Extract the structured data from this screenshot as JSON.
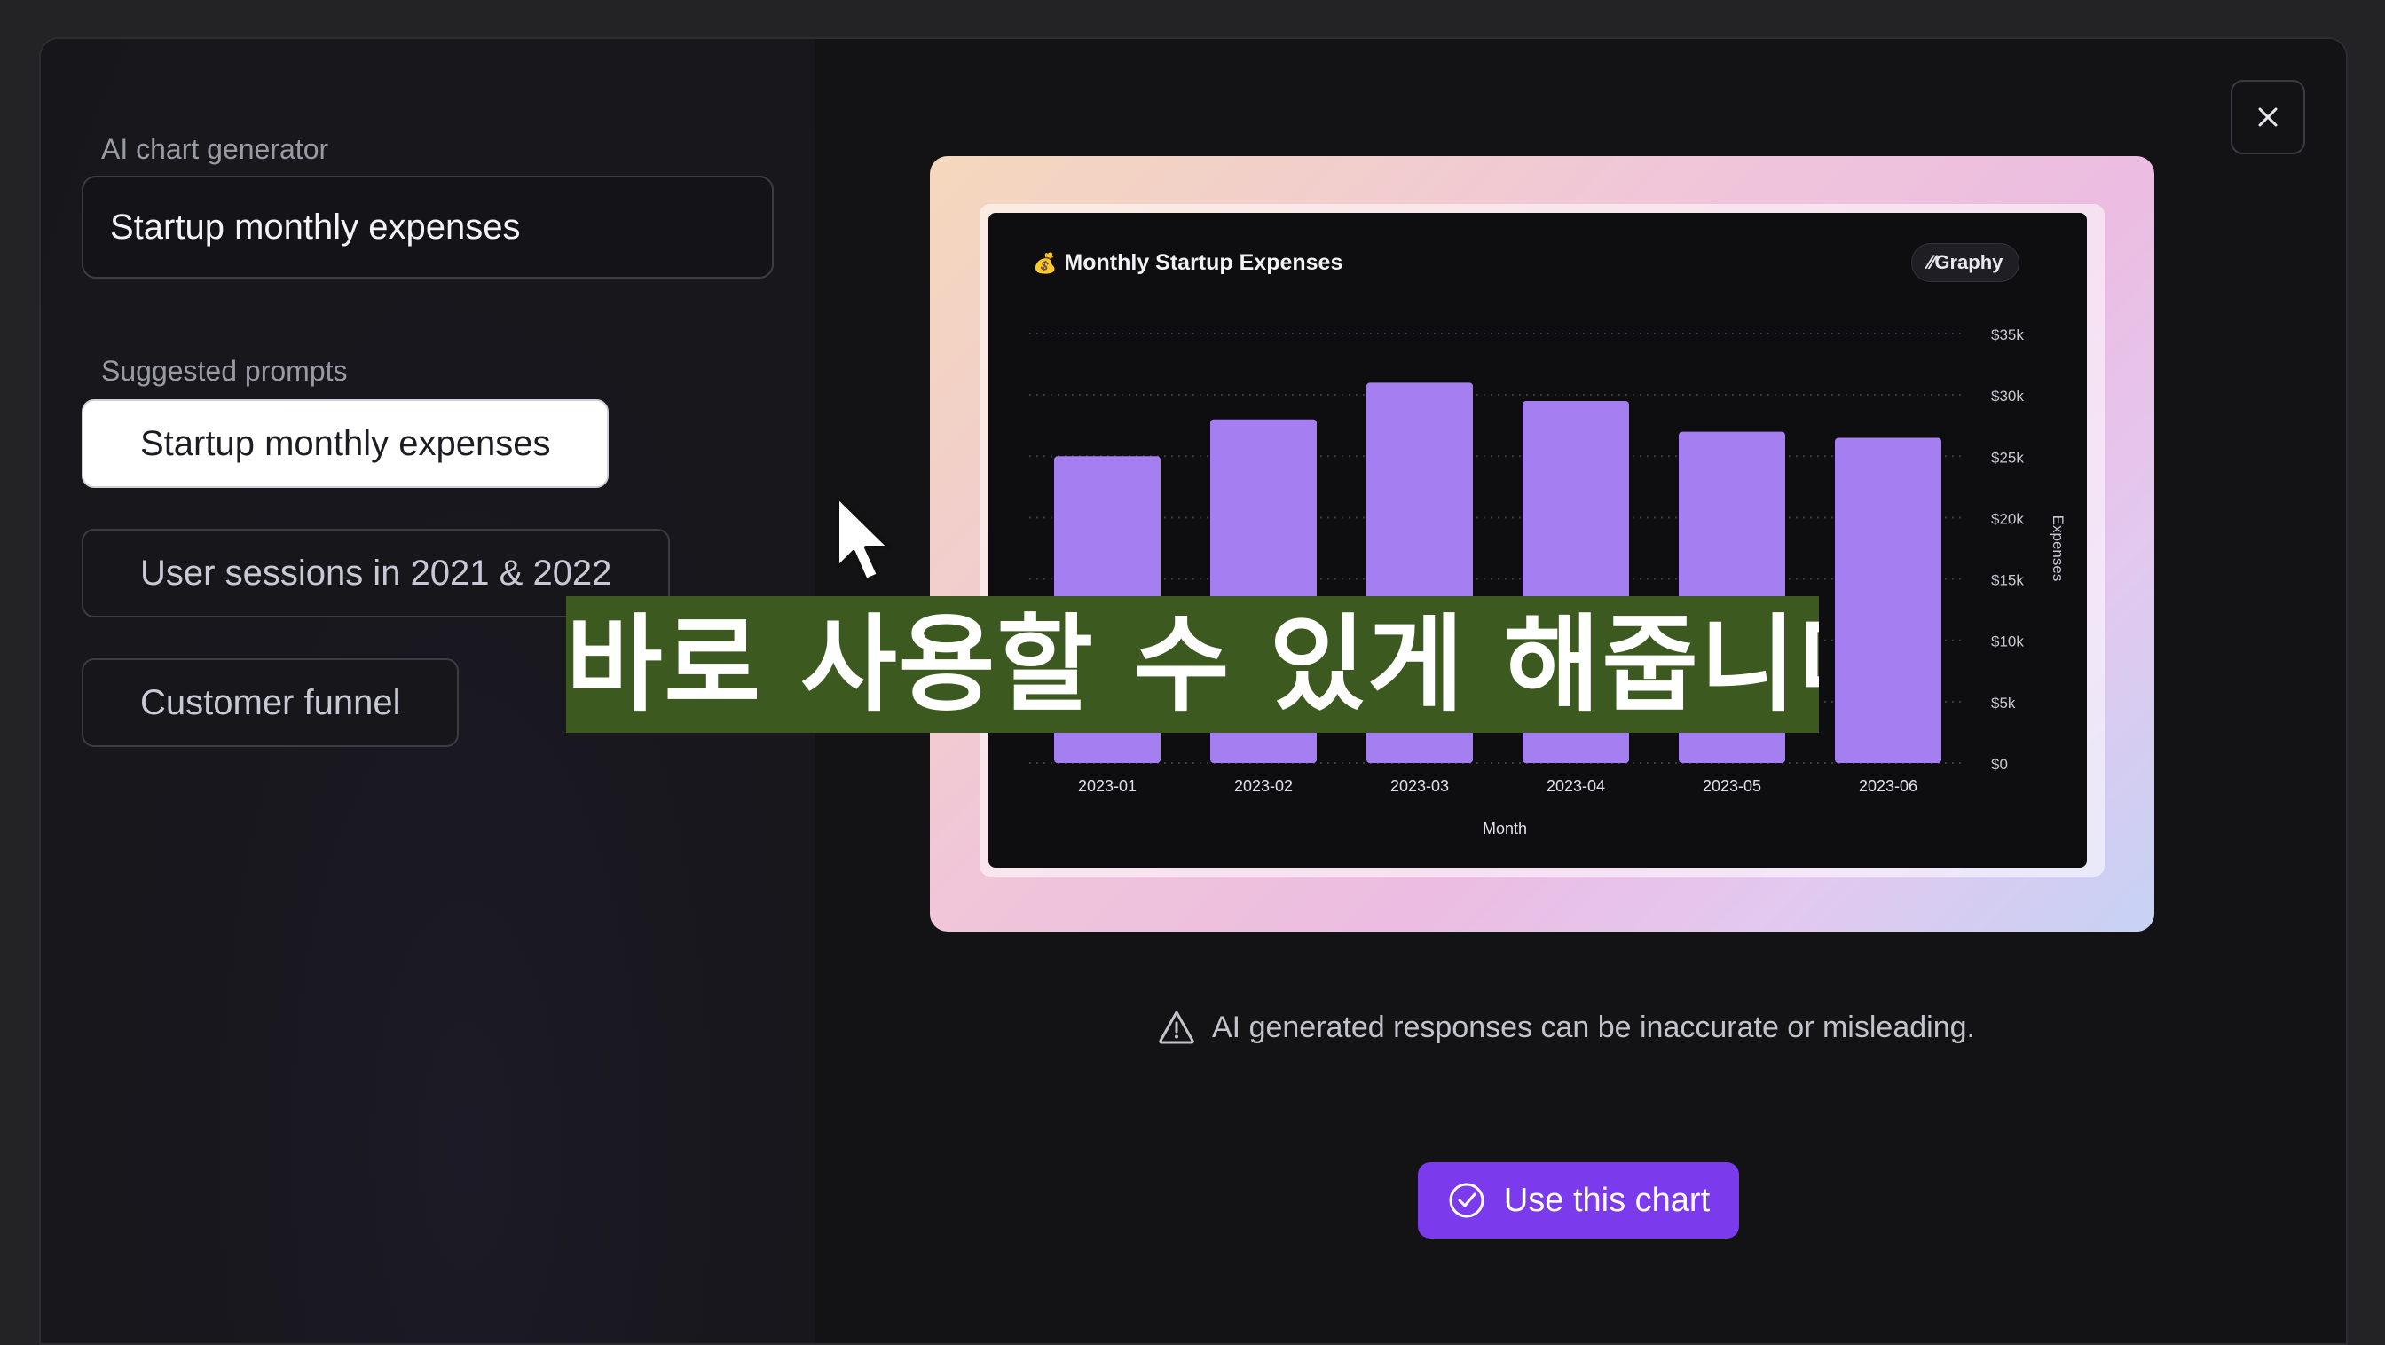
{
  "left_panel": {
    "title": "AI chart generator",
    "prompt_value": "Startup monthly expenses",
    "suggested_title": "Suggested prompts",
    "suggestions": [
      "Startup monthly expenses",
      "User sessions in 2021 & 2022",
      "Customer funnel"
    ]
  },
  "close_icon": "close-icon",
  "chart_card": {
    "title_emoji": "💰",
    "title": "Monthly Startup Expenses",
    "badge": "⁄⁄Graphy"
  },
  "chart_data": {
    "type": "bar",
    "title": "Monthly Startup Expenses",
    "categories": [
      "2023-01",
      "2023-02",
      "2023-03",
      "2023-04",
      "2023-05",
      "2023-06"
    ],
    "values": [
      25000,
      28000,
      31000,
      29500,
      27000,
      26500
    ],
    "xlabel": "Month",
    "ylabel": "Expenses",
    "ylim": [
      0,
      35000
    ],
    "yticks": [
      0,
      5000,
      10000,
      15000,
      20000,
      25000,
      30000,
      35000
    ],
    "ytick_labels": [
      "$0",
      "$5k",
      "$10k",
      "$15k",
      "$20k",
      "$25k",
      "$30k",
      "$35k"
    ],
    "grid": true,
    "bar_color": "#a57ff2"
  },
  "disclaimer": "AI generated responses can be inaccurate or misleading.",
  "use_button": "Use this chart",
  "accent_color": "#7c3aed",
  "subtitle_caption": "바로 사용할 수 있게 해줍니다"
}
